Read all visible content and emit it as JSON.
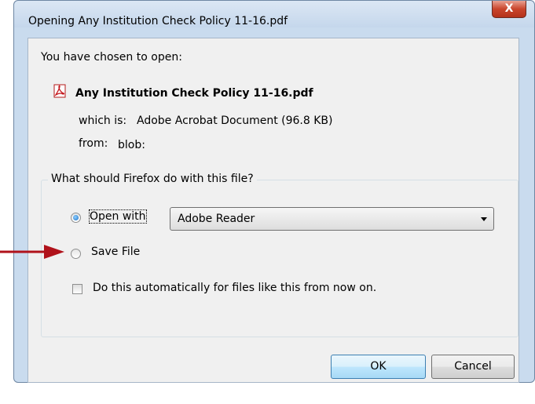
{
  "window": {
    "title": "Opening Any Institution Check Policy 11-16.pdf",
    "close_label": "X"
  },
  "content": {
    "intro": "You have chosen to open:",
    "file_name": "Any Institution Check Policy 11-16.pdf",
    "which_is_label": "which is:",
    "which_is_value": "Adobe Acrobat Document (96.8 KB)",
    "from_label": "from:",
    "from_value": "blob:"
  },
  "choice": {
    "legend": "What should Firefox do with this file?",
    "open_with": {
      "label": "Open with",
      "selected": true
    },
    "application": "Adobe Reader",
    "save_file": {
      "label": "Save File",
      "selected": false
    },
    "auto_checkbox": {
      "label": "Do this automatically for files like this from now on.",
      "checked": false
    }
  },
  "buttons": {
    "ok": "OK",
    "cancel": "Cancel"
  },
  "colors": {
    "annotation_arrow": "#b0121b",
    "accent": "#1b70c7"
  }
}
